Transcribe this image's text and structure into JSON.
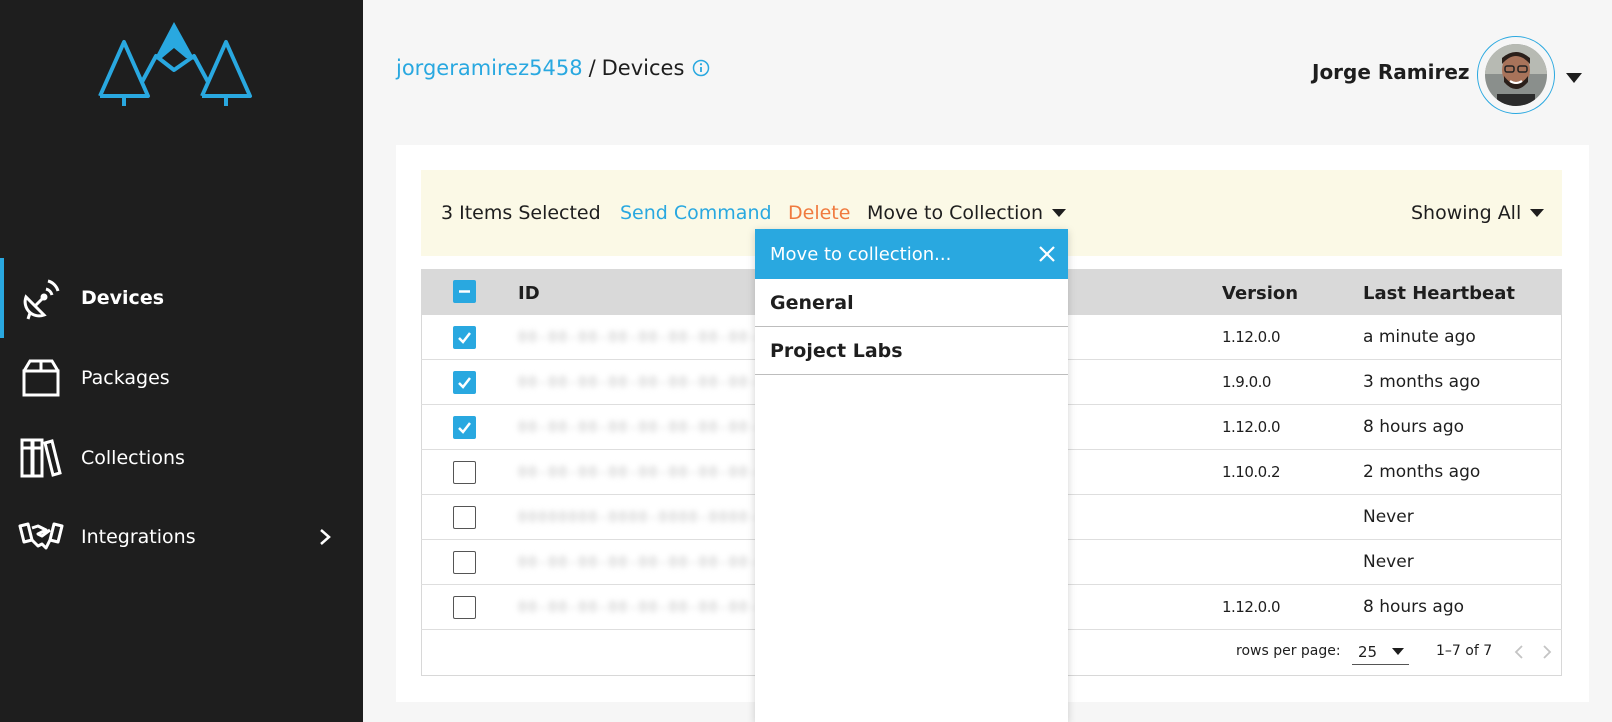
{
  "sidebar": {
    "items": [
      {
        "label": "Devices",
        "icon": "satellite-dish-icon",
        "active": true
      },
      {
        "label": "Packages",
        "icon": "package-box-icon",
        "active": false
      },
      {
        "label": "Collections",
        "icon": "books-icon",
        "active": false
      },
      {
        "label": "Integrations",
        "icon": "handshake-icon",
        "active": false,
        "has_submenu": true
      }
    ]
  },
  "header": {
    "breadcrumb_user": "jorgeramirez5458",
    "breadcrumb_sep": "/",
    "breadcrumb_page": "Devices",
    "user_name": "Jorge Ramirez"
  },
  "action_bar": {
    "selected_text": "3 Items Selected",
    "send_command": "Send Command",
    "delete": "Delete",
    "move_to_collection": "Move to Collection",
    "showing": "Showing All"
  },
  "table": {
    "columns": {
      "id": "ID",
      "version": "Version",
      "last_heartbeat": "Last Heartbeat"
    },
    "rows": [
      {
        "checked": true,
        "id": "00-00-00-00-00-00-00-00-00",
        "version": "1.12.0.0",
        "last_heartbeat": "a minute ago"
      },
      {
        "checked": true,
        "id": "00-00-00-00-00-00-00-00-00",
        "version": "1.9.0.0",
        "last_heartbeat": "3 months ago"
      },
      {
        "checked": true,
        "id": "00-00-00-00-00-00-00-00-00",
        "version": "1.12.0.0",
        "last_heartbeat": "8 hours ago"
      },
      {
        "checked": false,
        "id": "00-00-00-00-00-00-00-00-00",
        "version": "1.10.0.2",
        "last_heartbeat": "2 months ago"
      },
      {
        "checked": false,
        "id": "00000000-0000-0000-0000-00",
        "version": "",
        "last_heartbeat": "Never"
      },
      {
        "checked": false,
        "id": "00-00-00-00-00-00-00-00-00",
        "version": "",
        "last_heartbeat": "Never"
      },
      {
        "checked": false,
        "id": "00-00-00-00-00-00-00-00-00",
        "version": "1.12.0.0",
        "last_heartbeat": "8 hours ago"
      }
    ]
  },
  "pagination": {
    "rows_per_page_label": "rows per page:",
    "rows_per_page": "25",
    "range": "1–7 of 7"
  },
  "popover": {
    "title": "Move to collection...",
    "items": [
      "General",
      "Project Labs"
    ]
  },
  "colors": {
    "accent": "#29a8e0",
    "danger": "#f07a3e",
    "sidebar_bg": "#1e1e1e",
    "action_bar_bg": "#fbf9e6"
  }
}
